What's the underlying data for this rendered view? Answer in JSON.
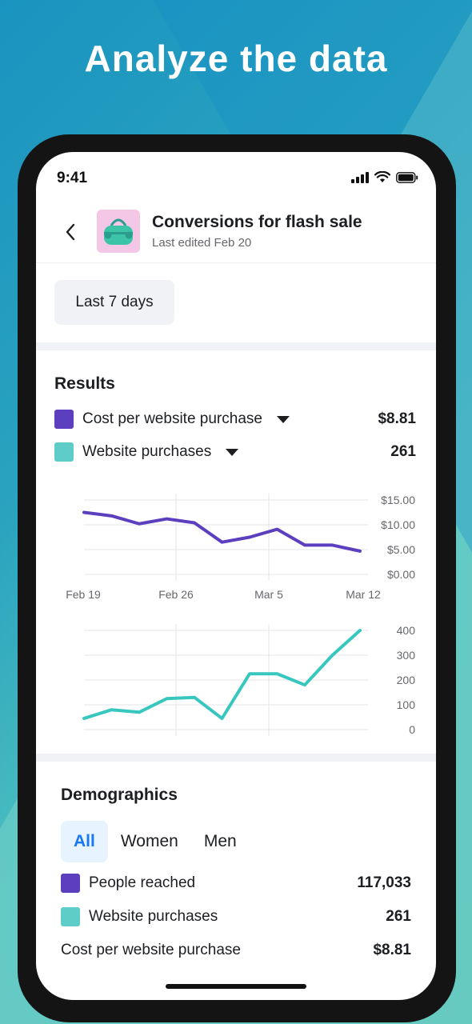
{
  "headline": "Analyze the data",
  "status_bar": {
    "time": "9:41"
  },
  "header": {
    "title": "Conversions for flash sale",
    "subtitle": "Last edited Feb 20"
  },
  "date_range": "Last 7 days",
  "results": {
    "title": "Results",
    "metrics": [
      {
        "label": "Cost per website purchase",
        "value": "$8.81",
        "color": "#5b3fbf"
      },
      {
        "label": "Website purchases",
        "value": "261",
        "color": "#5ecdc8"
      }
    ]
  },
  "chart_data": [
    {
      "type": "line",
      "series": [
        {
          "name": "Cost per website purchase",
          "color": "#5b3fbf",
          "values": [
            12.5,
            11.8,
            10.2,
            11.2,
            10.4,
            6.5,
            7.5,
            9.1,
            5.9,
            5.9,
            4.7
          ]
        }
      ],
      "x": [
        0,
        1,
        2,
        3,
        4,
        5,
        6,
        7,
        8,
        9,
        10
      ],
      "x_tick_labels": [
        "Feb 19",
        "Feb 26",
        "Mar 5",
        "Mar 12"
      ],
      "y_tick_labels": [
        "$15.00",
        "$10.00",
        "$5.00",
        "$0.00"
      ],
      "ylim": [
        0,
        15
      ],
      "grid": true
    },
    {
      "type": "line",
      "series": [
        {
          "name": "Website purchases",
          "color": "#38c7bf",
          "values": [
            45,
            80,
            70,
            125,
            130,
            45,
            225,
            225,
            180,
            300,
            400
          ]
        }
      ],
      "x": [
        0,
        1,
        2,
        3,
        4,
        5,
        6,
        7,
        8,
        9,
        10
      ],
      "y_tick_labels": [
        "400",
        "300",
        "200",
        "100",
        "0"
      ],
      "ylim": [
        0,
        400
      ],
      "grid": true
    }
  ],
  "demographics": {
    "title": "Demographics",
    "tabs": [
      "All",
      "Women",
      "Men"
    ],
    "rows": [
      {
        "label": "People reached",
        "value": "117,033",
        "color": "#5b3fbf"
      },
      {
        "label": "Website purchases",
        "value": "261",
        "color": "#5ecdc8"
      },
      {
        "label": "Cost per website purchase",
        "value": "$8.81"
      }
    ]
  }
}
